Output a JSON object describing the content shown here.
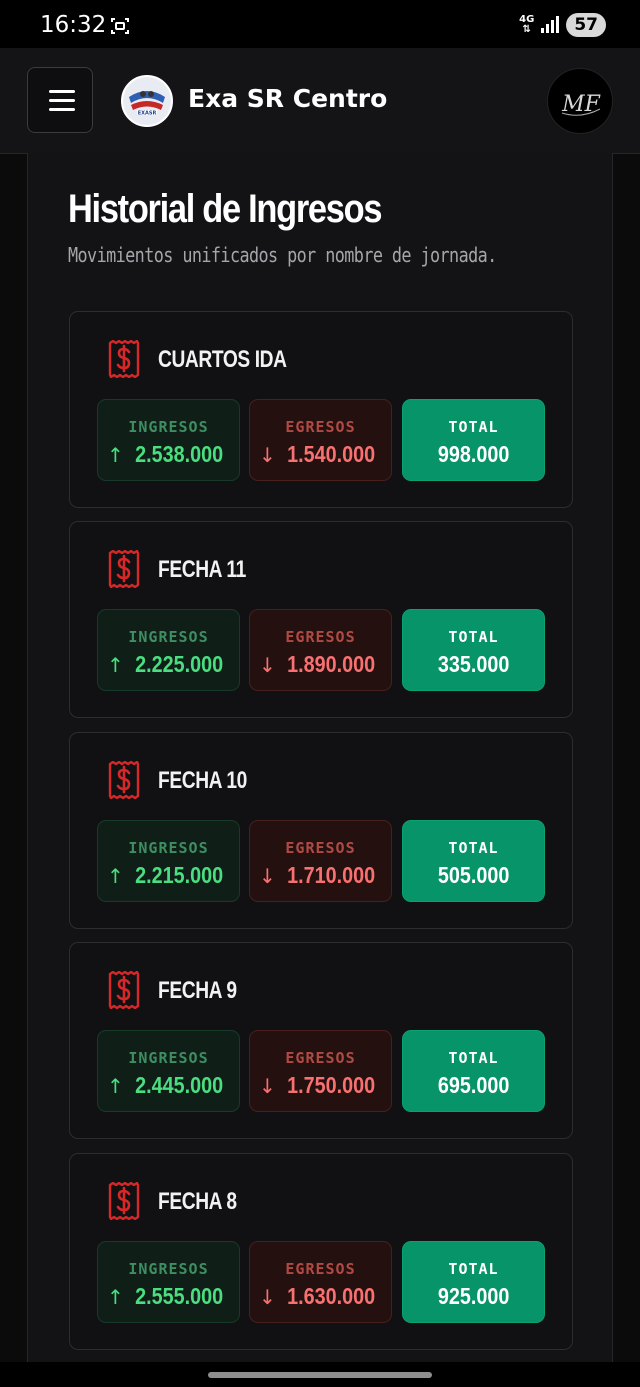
{
  "status_bar": {
    "time": "16:32",
    "network": "4G",
    "battery": "57"
  },
  "app_bar": {
    "title": "Exa SR Centro",
    "logo_text": "EXASR",
    "profile_initials": "MF"
  },
  "page": {
    "title": "Historial de Ingresos",
    "subtitle": "Movimientos unificados por nombre de jornada."
  },
  "labels": {
    "ingresos": "INGRESOS",
    "egresos": "EGRESOS",
    "total": "TOTAL"
  },
  "icons": {
    "up": "↑",
    "down": "↓"
  },
  "colors": {
    "accent_green": "#4ade80",
    "accent_red": "#f87171",
    "total_bg": "#079468",
    "icon_red": "#d62828"
  },
  "jornadas": [
    {
      "name": "CUARTOS IDA",
      "ingresos": "2.538.000",
      "egresos": "1.540.000",
      "total": "998.000"
    },
    {
      "name": "FECHA 11",
      "ingresos": "2.225.000",
      "egresos": "1.890.000",
      "total": "335.000"
    },
    {
      "name": "FECHA 10",
      "ingresos": "2.215.000",
      "egresos": "1.710.000",
      "total": "505.000"
    },
    {
      "name": "FECHA 9",
      "ingresos": "2.445.000",
      "egresos": "1.750.000",
      "total": "695.000"
    },
    {
      "name": "FECHA 8",
      "ingresos": "2.555.000",
      "egresos": "1.630.000",
      "total": "925.000"
    }
  ]
}
